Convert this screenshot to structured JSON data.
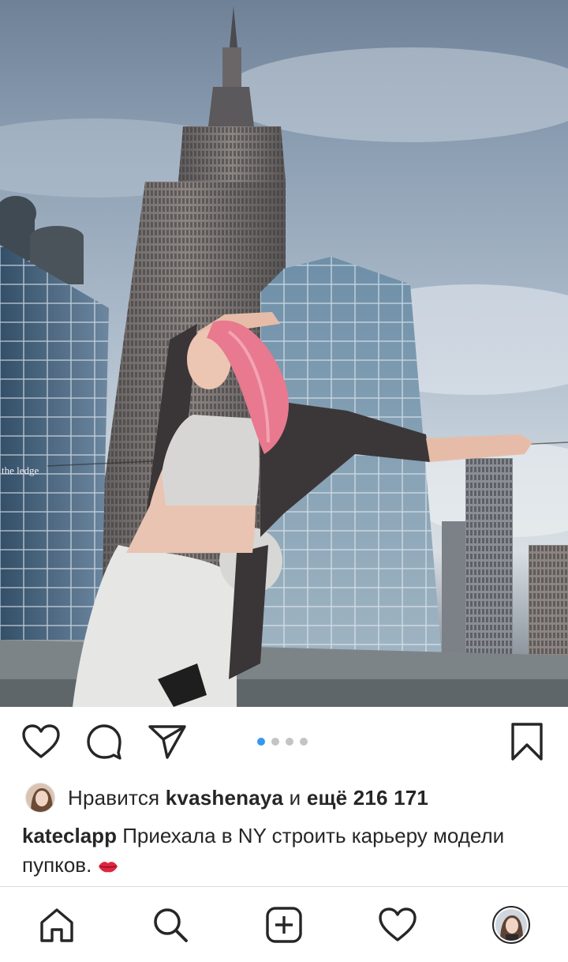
{
  "post": {
    "image": {
      "sign_text": "the ledge",
      "carousel": {
        "count": 4,
        "active_index": 0
      }
    },
    "actions": {
      "like_icon": "heart-icon",
      "comment_icon": "comment-icon",
      "share_icon": "paper-plane-icon",
      "save_icon": "bookmark-icon"
    },
    "likes": {
      "prefix": "Нравится",
      "user": "kvashenaya",
      "middle": "и",
      "rest": "ещё 216 171"
    },
    "caption": {
      "username": "kateclapp",
      "text": "Приехала в NY строить карьеру модели пупков.",
      "emoji": "👄"
    }
  },
  "tabbar": {
    "items": [
      "home-icon",
      "search-icon",
      "add-post-icon",
      "activity-heart-icon",
      "profile-avatar"
    ]
  },
  "colors": {
    "accent_dot": "#3897f0",
    "text": "#262626",
    "hair": "#e8798f"
  }
}
